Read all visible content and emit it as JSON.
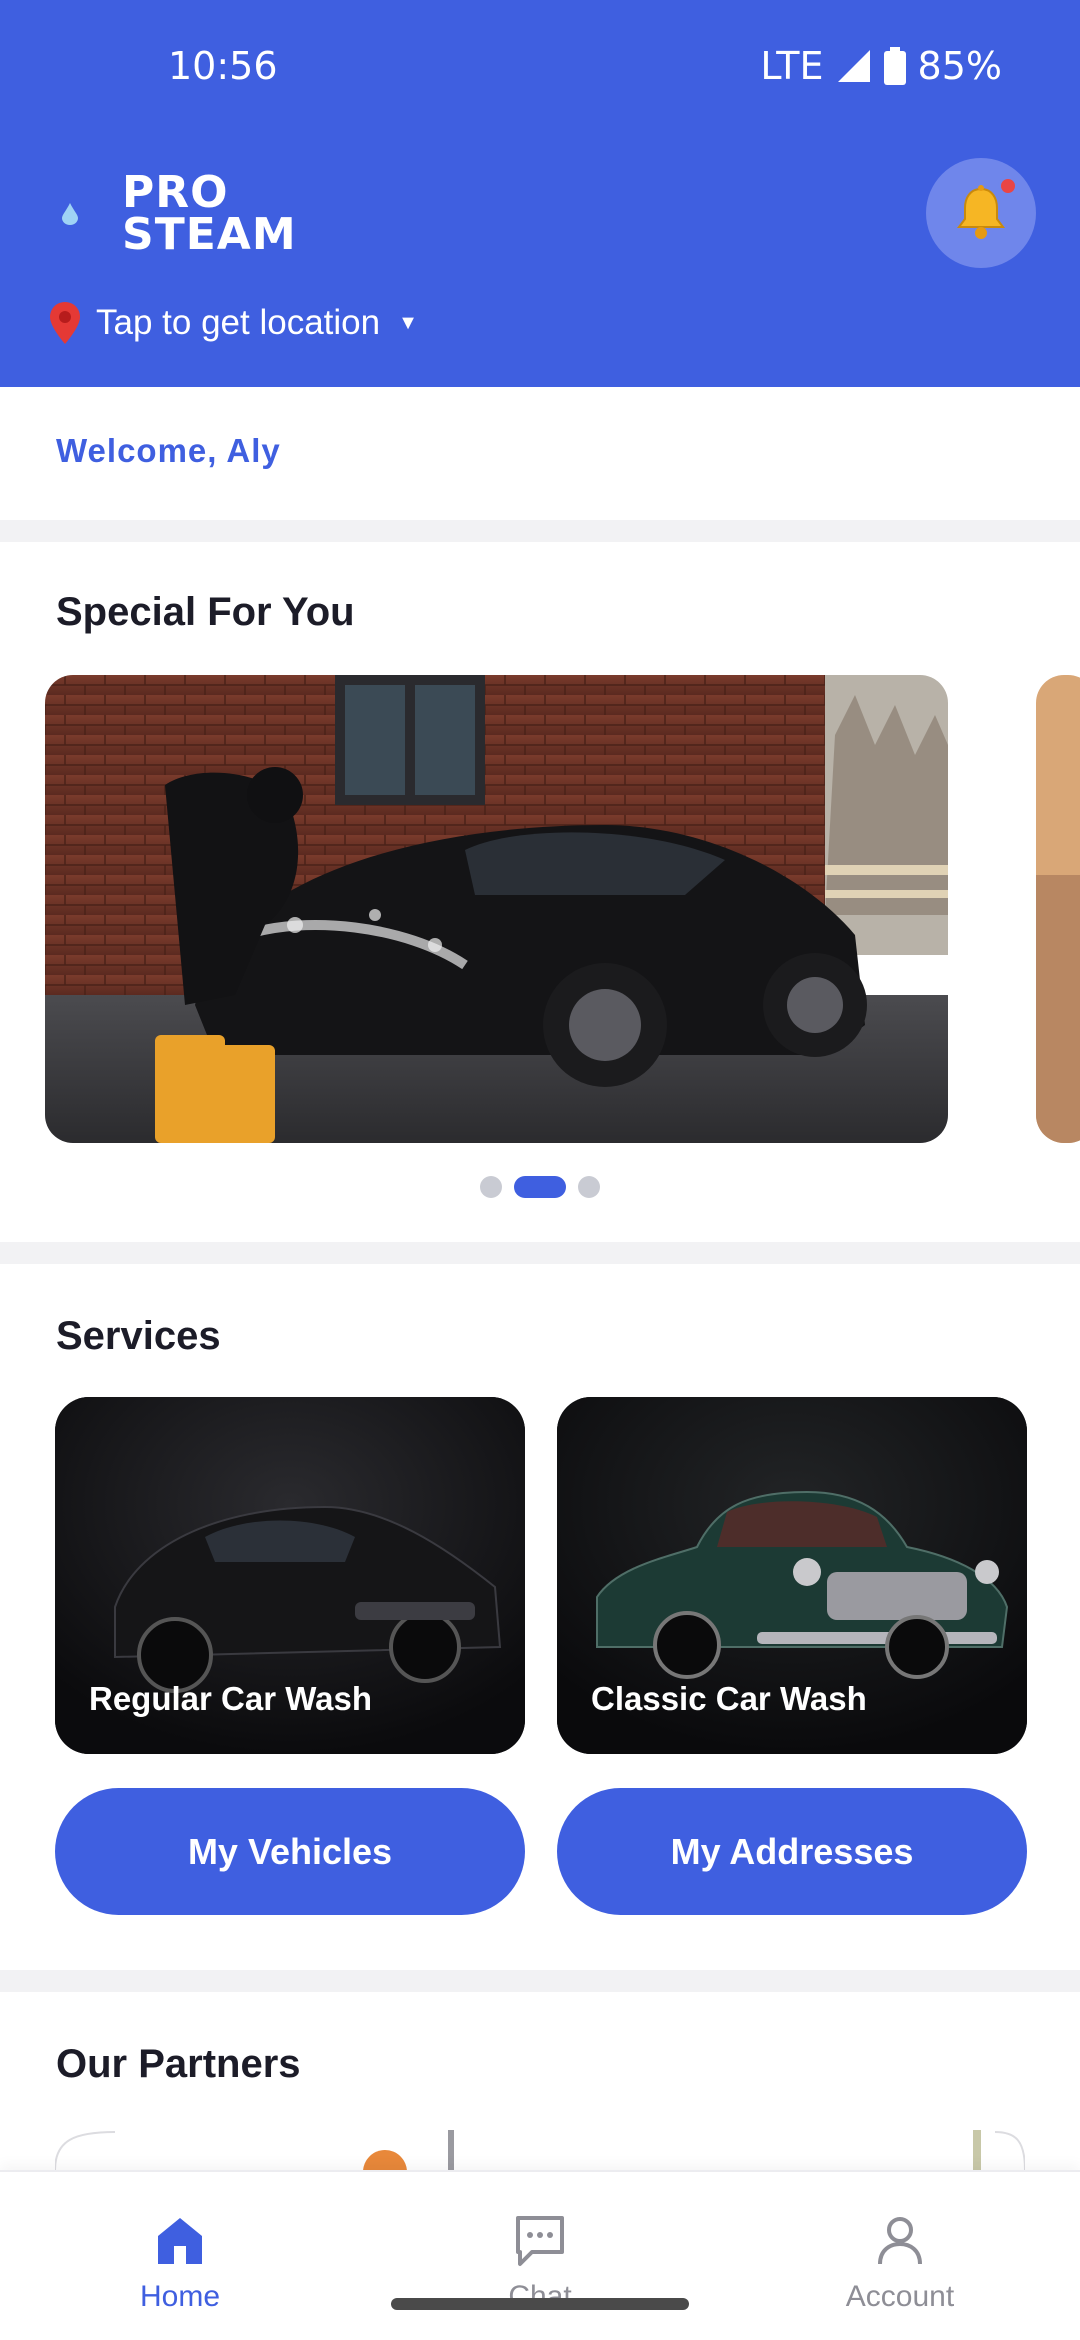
{
  "status_bar": {
    "time": "10:56",
    "network": "LTE",
    "battery": "85%"
  },
  "header": {
    "logo_line1": "PRO",
    "logo_line2": "STEAM",
    "location_text": "Tap to get location",
    "accent_color": "#3f5fe0"
  },
  "welcome": {
    "text": "Welcome, Aly"
  },
  "special": {
    "title": "Special For You",
    "carousel_active_index": 1,
    "carousel_count": 3
  },
  "services": {
    "title": "Services",
    "cards": [
      {
        "label": "Regular Car Wash"
      },
      {
        "label": "Classic Car Wash"
      }
    ],
    "buttons": [
      {
        "label": "My Vehicles"
      },
      {
        "label": "My Addresses"
      }
    ]
  },
  "partners": {
    "title": "Our Partners"
  },
  "bottom_nav": {
    "items": [
      {
        "label": "Home",
        "icon": "home-icon",
        "active": true
      },
      {
        "label": "Chat",
        "icon": "chat-icon",
        "active": false
      },
      {
        "label": "Account",
        "icon": "account-icon",
        "active": false
      }
    ]
  }
}
